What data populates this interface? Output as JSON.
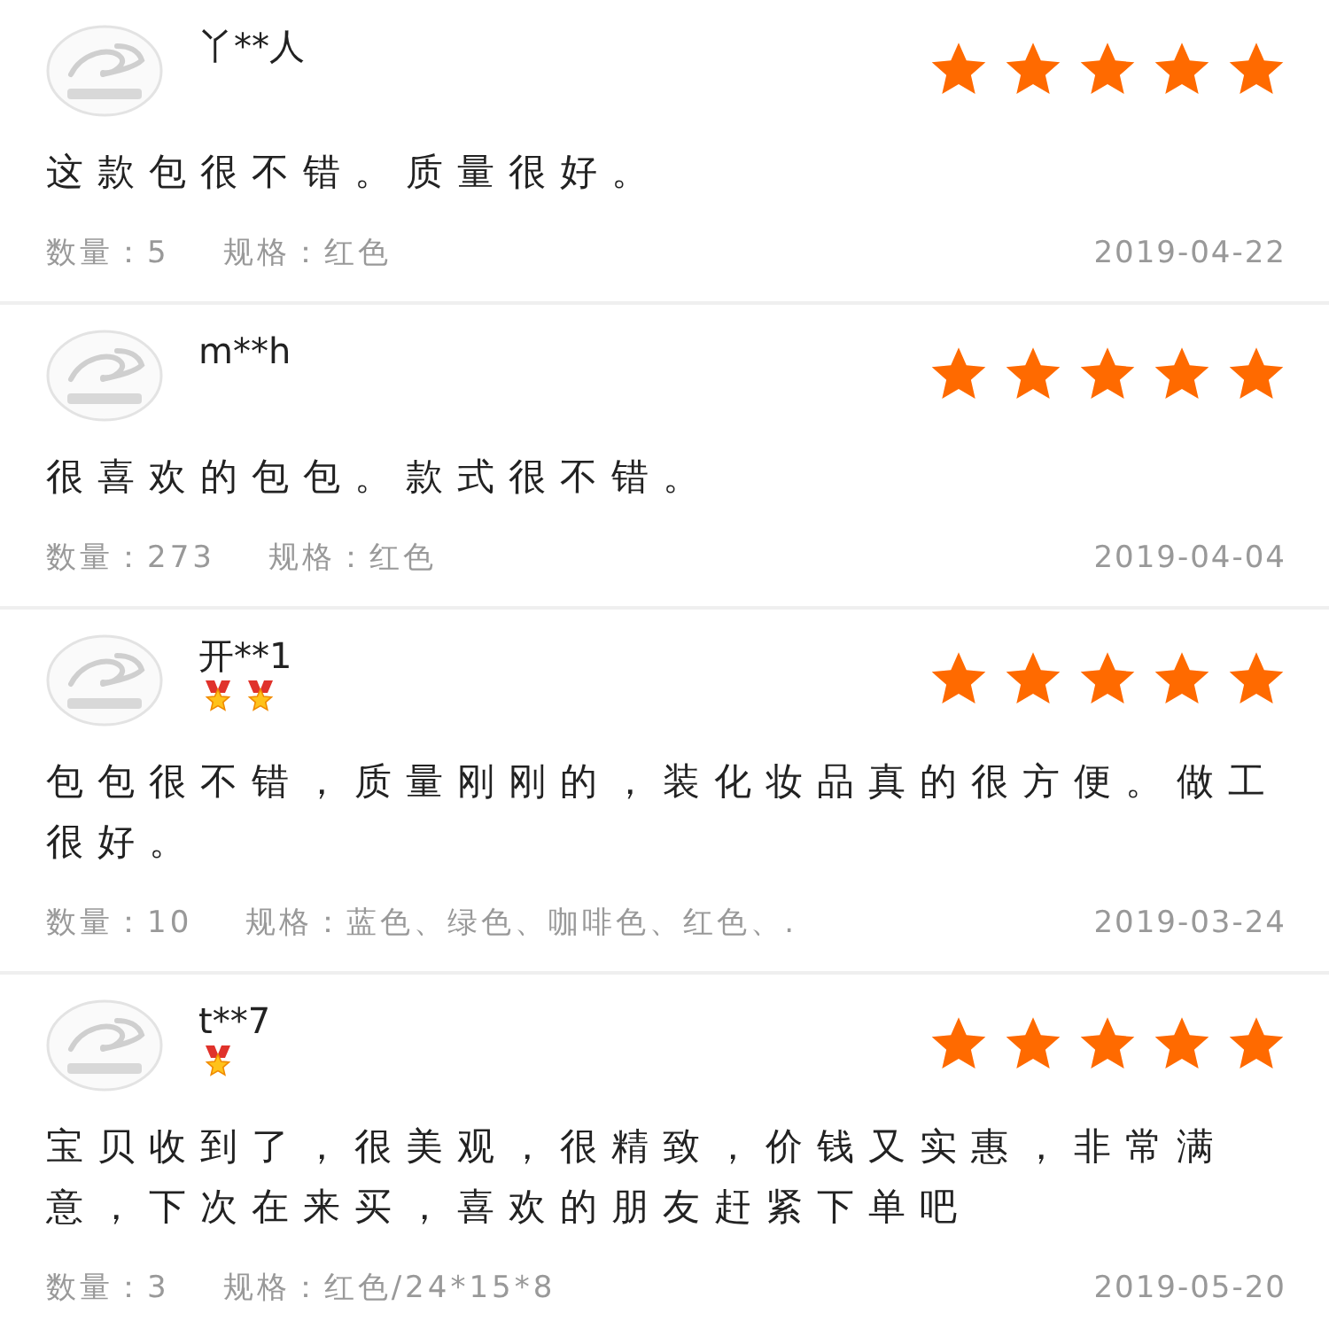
{
  "reviews": [
    {
      "user": "丫**人",
      "stars": 5,
      "comment": "这款包很不错。质量很好。",
      "quantity_label": "数量：",
      "quantity": "5",
      "spec_label": "规格：",
      "spec": "红色",
      "date": "2019-04-22"
    },
    {
      "user": "m**h",
      "stars": 5,
      "comment": "很喜欢的包包。款式很不错。",
      "quantity_label": "数量：",
      "quantity": "273",
      "spec_label": "规格：",
      "spec": "红色",
      "date": "2019-04-04"
    },
    {
      "user": "开**1",
      "medals": [
        {
          "kind": "medal"
        },
        {
          "kind": "medal"
        }
      ],
      "stars": 5,
      "comment": "包包很不错，质量刚刚的，装化妆品真的很方便。做工很好。",
      "quantity_label": "数量：",
      "quantity": "10",
      "spec_label": "规格：",
      "spec": "蓝色、绿色、咖啡色、红色、.",
      "date": "2019-03-24"
    },
    {
      "user": "t**7",
      "medals": [
        {
          "kind": "medal"
        }
      ],
      "stars": 5,
      "comment": "宝贝收到了，很美观，很精致，价钱又实惠，非常满意，下次在来买，喜欢的朋友赶紧下单吧",
      "quantity_label": "数量：",
      "quantity": "3",
      "spec_label": "规格：",
      "spec": "红色/24*15*8",
      "date": "2019-05-20"
    }
  ]
}
